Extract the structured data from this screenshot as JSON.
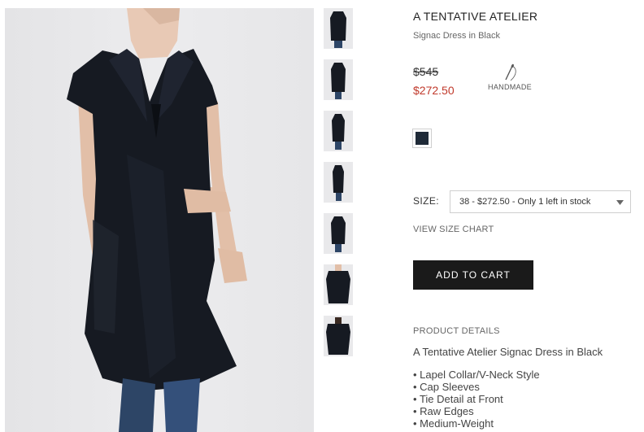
{
  "product": {
    "brand": "A TENTATIVE ATELIER",
    "name": "Signac Dress in Black",
    "price_original": "$545",
    "price_sale": "$272.50",
    "badge_label": "HANDMADE",
    "badge_icon": "needle-thread-icon",
    "swatch_color": "#1f2a38",
    "sale_color": "#c0392b"
  },
  "size": {
    "label": "SIZE:",
    "selected": "38 - $272.50 - Only 1 left in stock"
  },
  "size_chart_link": "VIEW SIZE CHART",
  "add_to_cart_label": "ADD TO CART",
  "details": {
    "heading": "PRODUCT DETAILS",
    "title": "A Tentative Atelier Signac Dress in Black",
    "bullets": [
      "Lapel Collar/V-Neck Style",
      "Cap Sleeves",
      "Tie Detail at Front",
      "Raw Edges",
      "Medium-Weight"
    ]
  },
  "gallery": {
    "thumbnail_count": 7
  }
}
